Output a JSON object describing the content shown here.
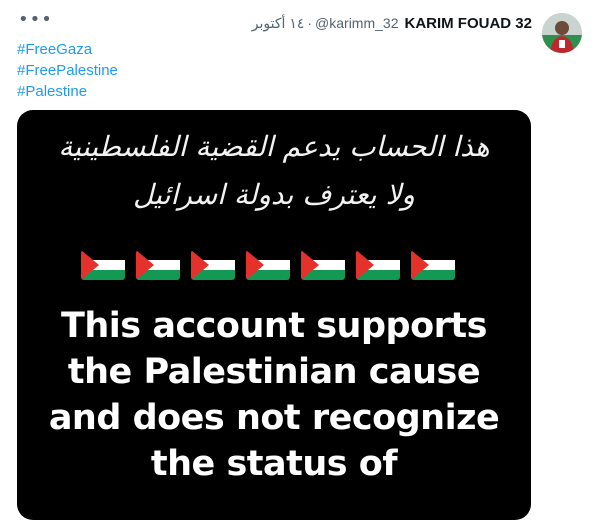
{
  "tweet": {
    "author_name": "KARIM FOUAD 32",
    "author_handle": "@karimm_32",
    "separator": "·",
    "date": "١٤ أكتوبر",
    "more_icon": "more-icon",
    "hashtags": [
      "#FreeGaza",
      "#FreePalestine",
      "#Palestine"
    ]
  },
  "image": {
    "arabic_lines": [
      "هذا الحساب يدعم القضية الفلسطينية",
      "ولا يعترف بدولة اسرائيل"
    ],
    "flag_count": 7,
    "flag_icon": "palestine-flag-icon",
    "english_lines": [
      "This account supports",
      "the Palestinian cause",
      "and does not recognize",
      "the status of"
    ]
  },
  "colors": {
    "hashtag": "#1d9bf0",
    "flag_black": "#000000",
    "flag_white": "#ffffff",
    "flag_green": "#149954",
    "flag_red": "#e4312b"
  }
}
